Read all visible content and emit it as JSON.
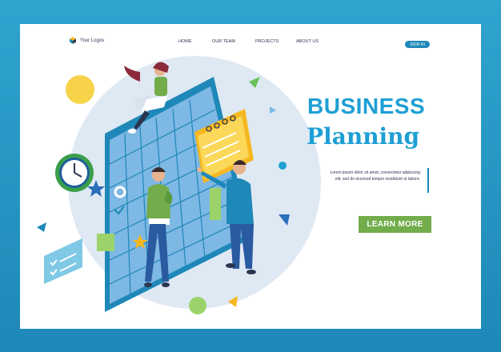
{
  "header": {
    "logo_text": "Your Logos",
    "nav": [
      "HOME",
      "OUR TEAM",
      "PROJECTS",
      "ABOUT US"
    ],
    "signin_label": "SIGN IN"
  },
  "hero": {
    "title_line1": "BUSINESS",
    "title_line2": "Planning",
    "description": "Lorem ipsum dolor sit amet, consectetur adipiscing elit, sed do eiusmod tempor incididunt ut labore.",
    "cta_label": "LEARN MORE"
  },
  "colors": {
    "background": "#1e88b8",
    "accent_blue": "#1e9fd4",
    "cta_green": "#72ac4b",
    "text_dark": "#2a3550"
  },
  "icons": [
    "logo-cube-icon",
    "clock-icon",
    "star-icon",
    "gear-icon",
    "checkmark-icon",
    "notepad-icon"
  ]
}
